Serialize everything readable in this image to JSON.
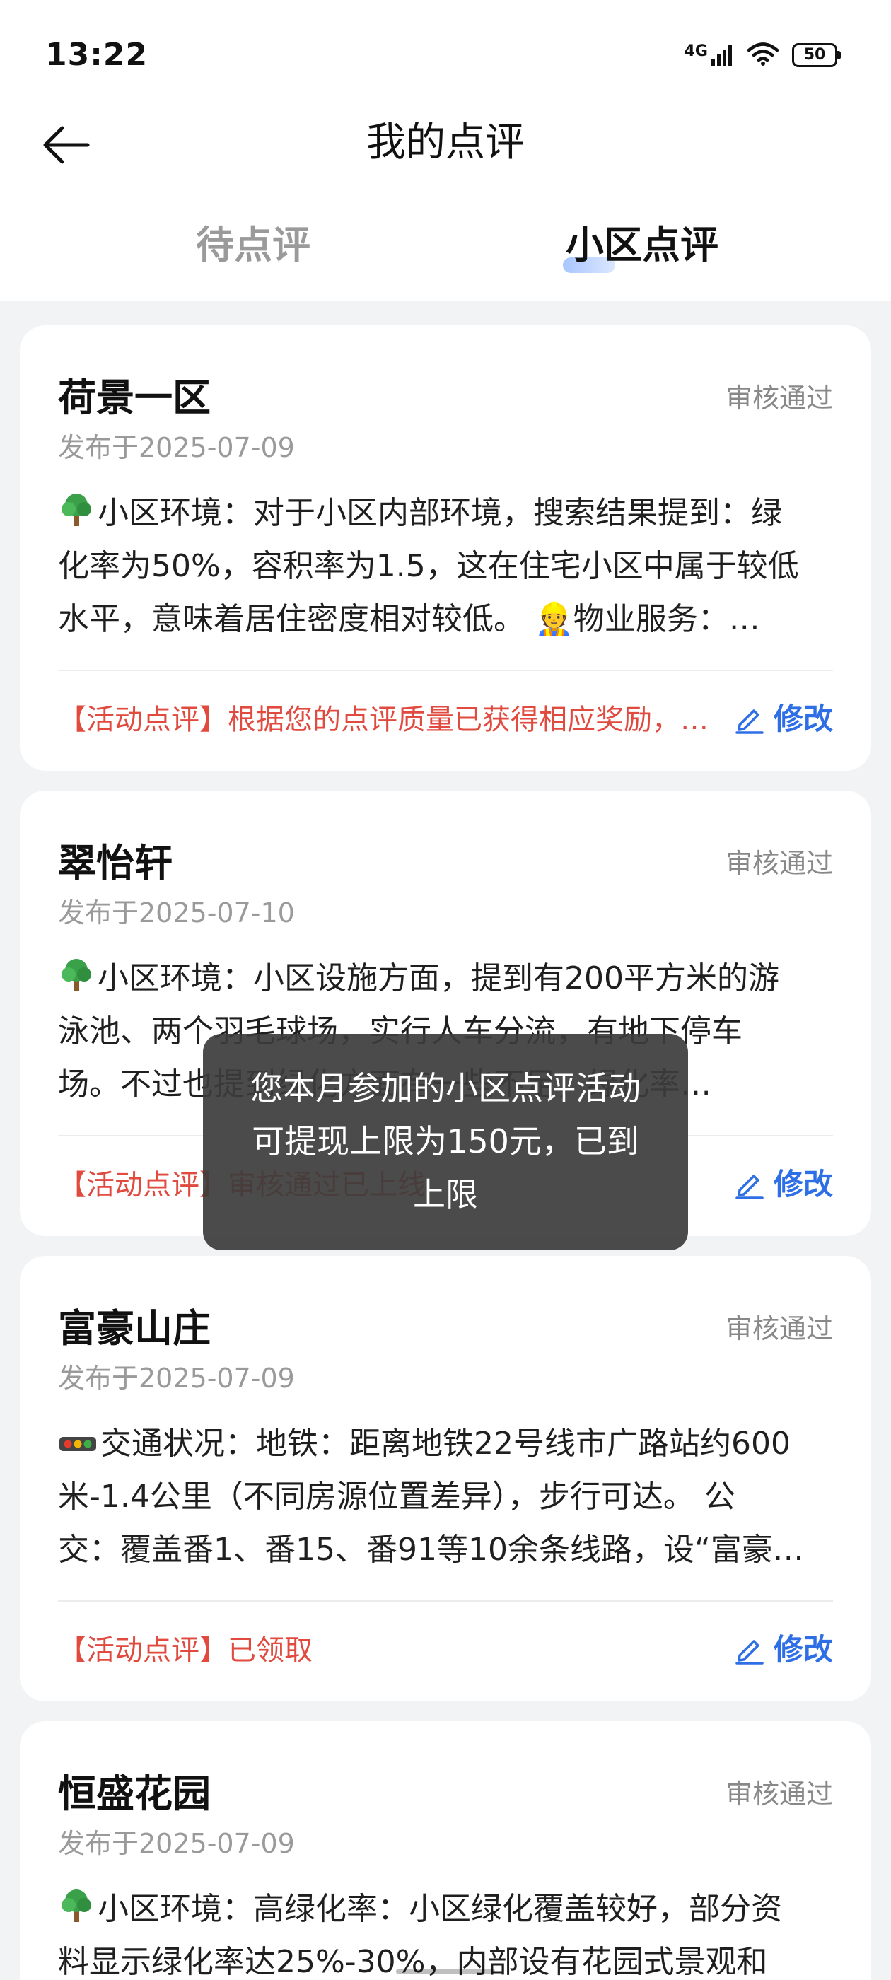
{
  "status_bar": {
    "time": "13:22",
    "network": "4G",
    "battery": "50"
  },
  "header": {
    "title": "我的点评"
  },
  "tabs": [
    {
      "label": "待点评",
      "active": false
    },
    {
      "label": "小区点评",
      "active": true
    }
  ],
  "reviews": [
    {
      "name": "荷景一区",
      "status": "审核通过",
      "date": "发布于2025-07-09",
      "content_lines": [
        "小区环境：对于小区内部环境，搜索结果提到：绿",
        "化率为50%，容积率为1.5，这在住宅小区中属于较低",
        "水平，意味着居住密度相对较低。 👷物业服务：…"
      ],
      "lead_icon": "tree-icon",
      "activity": "【活动点评】根据您的点评质量已获得相应奖励，…",
      "edit_label": "修改"
    },
    {
      "name": "翠怡轩",
      "status": "审核通过",
      "date": "发布于2025-07-10",
      "content_lines": [
        "小区环境：小区设施方面，提到有200平方米的游",
        "泳池、两个羽毛球场，实行人车分流，有地下停车",
        "场。不过也提到绿化方面有一些不足，绿化率…"
      ],
      "lead_icon": "tree-icon",
      "activity": "【活动点评】审核通过已上线",
      "edit_label": "修改"
    },
    {
      "name": "富豪山庄",
      "status": "审核通过",
      "date": "发布于2025-07-09",
      "content_lines": [
        "交通状况：地铁：距离地铁22号线市广路站约600",
        "米-1.4公里（不同房源位置差异），步行可达。 公",
        "交：覆盖番1、番15、番91等10余条线路，设“富豪…"
      ],
      "lead_icon": "traffic-light-icon",
      "activity": "【活动点评】已领取",
      "edit_label": "修改"
    },
    {
      "name": "恒盛花园",
      "status": "审核通过",
      "date": "发布于2025-07-09",
      "content_lines": [
        "小区环境：高绿化率：小区绿化覆盖较好，部分资",
        "料显示绿化率达25%-30%，内部设有花园式景观和"
      ],
      "lead_icon": "tree-icon",
      "activity": "",
      "edit_label": ""
    }
  ],
  "toast": {
    "lines": [
      "您本月参加的小区点评活动",
      "可提现上限为150元，已到",
      "上限"
    ]
  }
}
